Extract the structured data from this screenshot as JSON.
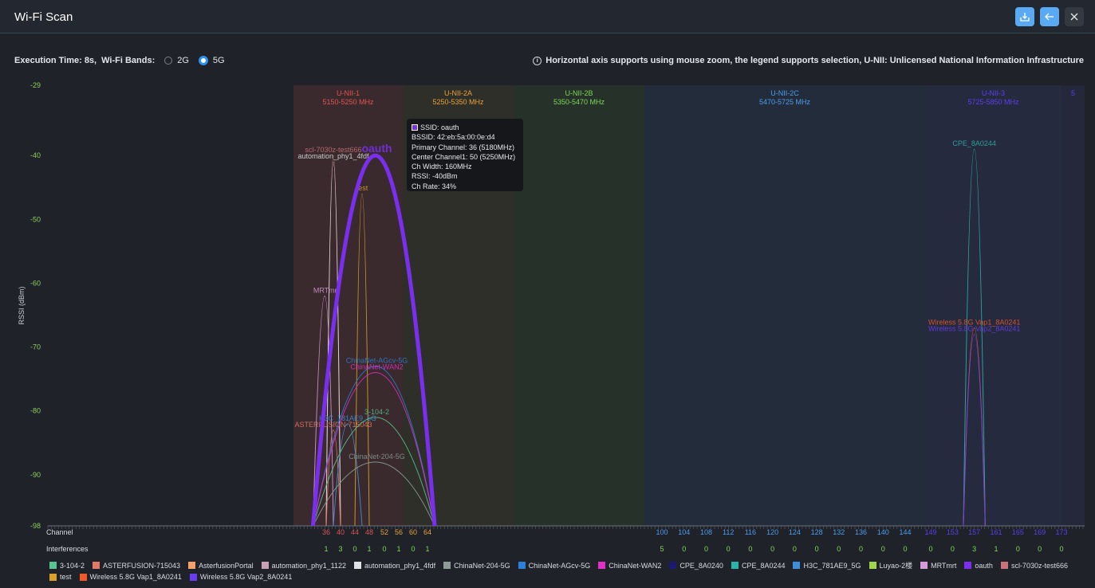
{
  "window": {
    "title": "Wi-Fi Scan",
    "buttons": [
      {
        "name": "download-icon",
        "glyph": "⤓"
      },
      {
        "name": "back-arrow-icon",
        "glyph": "←"
      },
      {
        "name": "close-icon",
        "glyph": "✕"
      }
    ]
  },
  "toolbar": {
    "execution_time": "Execution Time: 8s,",
    "bands_label": "Wi-Fi Bands:",
    "band_2g": "2G",
    "band_5g": "5G",
    "selected_band": "5G",
    "note": "Horizontal axis supports using mouse zoom, the legend supports selection, U-NII: Unlicensed National Information Infrastructure"
  },
  "tooltip": {
    "ssid": "SSID: oauth",
    "bssid": "BSSID: 42:eb:5a:00:0e:d4",
    "primary": "Primary Channel: 36 (5180MHz)",
    "center": "Center Channel1: 50 (5250MHz)",
    "width": "Ch Width: 160MHz",
    "rssi": "RSSI: -40dBm",
    "rate": "Ch Rate: 34%"
  },
  "chart_data": {
    "type": "area",
    "ylabel": "RSSI (dBm)",
    "ylim": [
      -98,
      -29
    ],
    "yticks": [
      -29,
      -40,
      -50,
      -60,
      -70,
      -80,
      -90,
      -98
    ],
    "row_labels": {
      "channel": "Channel",
      "interferences": "Interferences"
    },
    "bands": [
      {
        "name": "U-NII-1",
        "range": "5150-5250 MHz",
        "color": "#e0534f",
        "fill": "#3a2a2d"
      },
      {
        "name": "U-NII-2A",
        "range": "5250-5350 MHz",
        "color": "#e8a13a",
        "fill": "#2f2f29"
      },
      {
        "name": "U-NII-2B",
        "range": "5350-5470 MHz",
        "color": "#7ed957",
        "fill": "#263129"
      },
      {
        "name": "U-NII-2C",
        "range": "5470-5725 MHz",
        "color": "#4c9df0",
        "fill": "#232c3a"
      },
      {
        "name": "U-NII-3",
        "range": "5725-5850 MHz",
        "color": "#5b3ff0",
        "fill": "#262a3e"
      },
      {
        "name": "5",
        "range": "",
        "color": "#5b3ff0",
        "fill": "#24283a"
      }
    ],
    "channels": [
      {
        "ch": "36",
        "intf": "1",
        "color": "#e0534f"
      },
      {
        "ch": "40",
        "intf": "3",
        "color": "#e0534f"
      },
      {
        "ch": "44",
        "intf": "0",
        "color": "#e0534f"
      },
      {
        "ch": "48",
        "intf": "1",
        "color": "#e0534f"
      },
      {
        "ch": "52",
        "intf": "0",
        "color": "#e8a13a"
      },
      {
        "ch": "56",
        "intf": "1",
        "color": "#e8a13a"
      },
      {
        "ch": "60",
        "intf": "0",
        "color": "#e8a13a"
      },
      {
        "ch": "64",
        "intf": "1",
        "color": "#e8a13a"
      },
      {
        "ch": "100",
        "intf": "5",
        "color": "#4c9df0"
      },
      {
        "ch": "104",
        "intf": "0",
        "color": "#4c9df0"
      },
      {
        "ch": "108",
        "intf": "0",
        "color": "#4c9df0"
      },
      {
        "ch": "112",
        "intf": "0",
        "color": "#4c9df0"
      },
      {
        "ch": "116",
        "intf": "0",
        "color": "#4c9df0"
      },
      {
        "ch": "120",
        "intf": "0",
        "color": "#4c9df0"
      },
      {
        "ch": "124",
        "intf": "0",
        "color": "#4c9df0"
      },
      {
        "ch": "128",
        "intf": "0",
        "color": "#4c9df0"
      },
      {
        "ch": "132",
        "intf": "0",
        "color": "#4c9df0"
      },
      {
        "ch": "136",
        "intf": "0",
        "color": "#4c9df0"
      },
      {
        "ch": "140",
        "intf": "0",
        "color": "#4c9df0"
      },
      {
        "ch": "144",
        "intf": "0",
        "color": "#4c9df0"
      },
      {
        "ch": "149",
        "intf": "0",
        "color": "#5b3ff0"
      },
      {
        "ch": "153",
        "intf": "0",
        "color": "#5b3ff0"
      },
      {
        "ch": "157",
        "intf": "3",
        "color": "#5b3ff0"
      },
      {
        "ch": "161",
        "intf": "1",
        "color": "#5b3ff0"
      },
      {
        "ch": "165",
        "intf": "0",
        "color": "#5b3ff0"
      },
      {
        "ch": "169",
        "intf": "0",
        "color": "#5b3ff0"
      },
      {
        "ch": "173",
        "intf": "0",
        "color": "#5b3ff0"
      }
    ],
    "series": [
      {
        "name": "scl-7030z-test666",
        "color": "#c9727a",
        "center": 38,
        "width": 20,
        "rssi": -40,
        "label": "scl-7030z-test666"
      },
      {
        "name": "automation_phy1_4fdf",
        "color": "#dfe3e8",
        "center": 38,
        "width": 20,
        "rssi": -41,
        "label": "automation_phy1_4fdf"
      },
      {
        "name": "MRTmrt",
        "color": "#d79ad8",
        "center": 36,
        "width": 20,
        "rssi": -62,
        "label": "MRTmrt"
      },
      {
        "name": "test",
        "color": "#d8a12a",
        "center": 46,
        "width": 20,
        "rssi": -46,
        "label": "test"
      },
      {
        "name": "ASTERFUSION-715043",
        "color": "#e07a66",
        "center": 38,
        "width": 20,
        "rssi": -83,
        "label": "ASTERFUSION-715043"
      },
      {
        "name": "H3C_781AE9_5G",
        "color": "#3f8ed8",
        "center": 42,
        "width": 40,
        "rssi": -82,
        "label": "H3C_781AE9_5G"
      },
      {
        "name": "3-104-2",
        "color": "#58c48f",
        "center": 50,
        "width": 160,
        "rssi": -81,
        "label": "3-104-2"
      },
      {
        "name": "ChinaNet-204-5G",
        "color": "#8a9c95",
        "center": 50,
        "width": 160,
        "rssi": -88,
        "label": "ChinaNet-204-5G"
      },
      {
        "name": "ChinaNet-AGcv-5G",
        "color": "#2c7fd6",
        "center": 50,
        "width": 160,
        "rssi": -73,
        "label": "ChinaNet-AGcv-5G"
      },
      {
        "name": "ChinaNet-WAN2",
        "color": "#e030c8",
        "center": 50,
        "width": 160,
        "rssi": -74,
        "label": "ChinaNet-WAN2"
      },
      {
        "name": "oauth",
        "color": "#7a2ff0",
        "center": 50,
        "width": 160,
        "rssi": -40,
        "label": "oauth"
      },
      {
        "name": "CPE_8A0244",
        "color": "#2bb3a9",
        "center": 157,
        "width": 20,
        "rssi": -39,
        "label": "CPE_8A0244"
      },
      {
        "name": "Wireless 5.8G Vap1_8A0241",
        "color": "#f05a28",
        "center": 157,
        "width": 20,
        "rssi": -67,
        "label": "Wireless 5.8G Vap1_8A0241"
      },
      {
        "name": "Wireless 5.8G Vap2_8A0241",
        "color": "#6b3df0",
        "center": 157,
        "width": 20,
        "rssi": -68,
        "label": "Wireless 5.8G Vap2_8A0241"
      }
    ]
  },
  "legend": [
    {
      "label": "3-104-2",
      "color": "#58c48f"
    },
    {
      "label": "ASTERFUSION-715043",
      "color": "#e07a66"
    },
    {
      "label": "AsterfusionPortal",
      "color": "#f3a06b"
    },
    {
      "label": "automation_phy1_1122",
      "color": "#c7a0b6"
    },
    {
      "label": "automation_phy1_4fdf",
      "color": "#dfe3e8"
    },
    {
      "label": "ChinaNet-204-5G",
      "color": "#8a9c95"
    },
    {
      "label": "ChinaNet-AGcv-5G",
      "color": "#2c7fd6"
    },
    {
      "label": "ChinaNet-WAN2",
      "color": "#e030c8"
    },
    {
      "label": "CPE_8A0240",
      "color": "#1a1a6e"
    },
    {
      "label": "CPE_8A0244",
      "color": "#2bb3a9"
    },
    {
      "label": "H3C_781AE9_5G",
      "color": "#3f8ed8"
    },
    {
      "label": "Luyao-2楼",
      "color": "#9fd54a"
    },
    {
      "label": "MRTmrt",
      "color": "#d79ad8"
    },
    {
      "label": "oauth",
      "color": "#7a2ff0"
    },
    {
      "label": "scl-7030z-test666",
      "color": "#c9727a"
    },
    {
      "label": "test",
      "color": "#d8a12a"
    },
    {
      "label": "Wireless 5.8G Vap1_8A0241",
      "color": "#f05a28"
    },
    {
      "label": "Wireless 5.8G Vap2_8A0241",
      "color": "#6b3df0"
    }
  ]
}
